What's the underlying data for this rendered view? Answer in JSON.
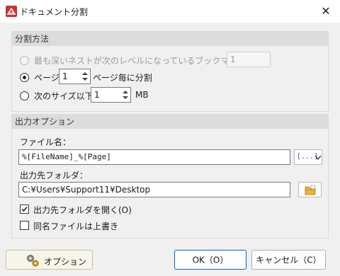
{
  "window": {
    "title": "ドキュメント分割",
    "close_glyph": "✕"
  },
  "split_method": {
    "heading": "分割方法",
    "option_bookmark": {
      "label": "最も深いネストが次のレベルになっているブックマークを使用",
      "value": "1"
    },
    "option_pages": {
      "label": "ページ:",
      "value": "1",
      "suffix": "ページ毎に分割"
    },
    "option_size": {
      "label": "次のサイズ以下:",
      "value": "1",
      "unit": "MB"
    }
  },
  "output_options": {
    "heading": "出力オプション",
    "filename_label": "ファイル名：",
    "filename_value": "%[FileName]_%[Page]",
    "macro_button_glyph": "[...]",
    "folder_label": "出力先フォルダ：",
    "folder_value": "C:¥Users¥Support11¥Desktop",
    "open_folder_label": "出力先フォルダを開く(O)",
    "overwrite_label": "同名ファイルは上書き"
  },
  "footer": {
    "options_button": "オプション",
    "ok_button": "OK（O）",
    "cancel_button": "キャンセル（C）"
  },
  "icons": [
    "app-logo-icon",
    "close-icon",
    "spin-up-icon",
    "spin-down-icon",
    "macro-insert-icon",
    "browse-folder-icon",
    "checkmark-icon",
    "gears-icon"
  ],
  "colors": {
    "accent": "#0067c0",
    "app_icon": "#c8312f",
    "folder": "#e8b43a"
  }
}
